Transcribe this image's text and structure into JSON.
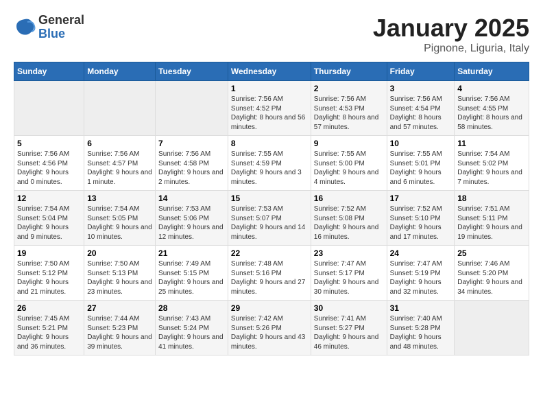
{
  "logo": {
    "general": "General",
    "blue": "Blue"
  },
  "title": {
    "month": "January 2025",
    "location": "Pignone, Liguria, Italy"
  },
  "headers": [
    "Sunday",
    "Monday",
    "Tuesday",
    "Wednesday",
    "Thursday",
    "Friday",
    "Saturday"
  ],
  "weeks": [
    [
      {
        "day": "",
        "info": ""
      },
      {
        "day": "",
        "info": ""
      },
      {
        "day": "",
        "info": ""
      },
      {
        "day": "1",
        "info": "Sunrise: 7:56 AM\nSunset: 4:52 PM\nDaylight: 8 hours\nand 56 minutes."
      },
      {
        "day": "2",
        "info": "Sunrise: 7:56 AM\nSunset: 4:53 PM\nDaylight: 8 hours\nand 57 minutes."
      },
      {
        "day": "3",
        "info": "Sunrise: 7:56 AM\nSunset: 4:54 PM\nDaylight: 8 hours\nand 57 minutes."
      },
      {
        "day": "4",
        "info": "Sunrise: 7:56 AM\nSunset: 4:55 PM\nDaylight: 8 hours\nand 58 minutes."
      }
    ],
    [
      {
        "day": "5",
        "info": "Sunrise: 7:56 AM\nSunset: 4:56 PM\nDaylight: 9 hours\nand 0 minutes."
      },
      {
        "day": "6",
        "info": "Sunrise: 7:56 AM\nSunset: 4:57 PM\nDaylight: 9 hours\nand 1 minute."
      },
      {
        "day": "7",
        "info": "Sunrise: 7:56 AM\nSunset: 4:58 PM\nDaylight: 9 hours\nand 2 minutes."
      },
      {
        "day": "8",
        "info": "Sunrise: 7:55 AM\nSunset: 4:59 PM\nDaylight: 9 hours\nand 3 minutes."
      },
      {
        "day": "9",
        "info": "Sunrise: 7:55 AM\nSunset: 5:00 PM\nDaylight: 9 hours\nand 4 minutes."
      },
      {
        "day": "10",
        "info": "Sunrise: 7:55 AM\nSunset: 5:01 PM\nDaylight: 9 hours\nand 6 minutes."
      },
      {
        "day": "11",
        "info": "Sunrise: 7:54 AM\nSunset: 5:02 PM\nDaylight: 9 hours\nand 7 minutes."
      }
    ],
    [
      {
        "day": "12",
        "info": "Sunrise: 7:54 AM\nSunset: 5:04 PM\nDaylight: 9 hours\nand 9 minutes."
      },
      {
        "day": "13",
        "info": "Sunrise: 7:54 AM\nSunset: 5:05 PM\nDaylight: 9 hours\nand 10 minutes."
      },
      {
        "day": "14",
        "info": "Sunrise: 7:53 AM\nSunset: 5:06 PM\nDaylight: 9 hours\nand 12 minutes."
      },
      {
        "day": "15",
        "info": "Sunrise: 7:53 AM\nSunset: 5:07 PM\nDaylight: 9 hours\nand 14 minutes."
      },
      {
        "day": "16",
        "info": "Sunrise: 7:52 AM\nSunset: 5:08 PM\nDaylight: 9 hours\nand 16 minutes."
      },
      {
        "day": "17",
        "info": "Sunrise: 7:52 AM\nSunset: 5:10 PM\nDaylight: 9 hours\nand 17 minutes."
      },
      {
        "day": "18",
        "info": "Sunrise: 7:51 AM\nSunset: 5:11 PM\nDaylight: 9 hours\nand 19 minutes."
      }
    ],
    [
      {
        "day": "19",
        "info": "Sunrise: 7:50 AM\nSunset: 5:12 PM\nDaylight: 9 hours\nand 21 minutes."
      },
      {
        "day": "20",
        "info": "Sunrise: 7:50 AM\nSunset: 5:13 PM\nDaylight: 9 hours\nand 23 minutes."
      },
      {
        "day": "21",
        "info": "Sunrise: 7:49 AM\nSunset: 5:15 PM\nDaylight: 9 hours\nand 25 minutes."
      },
      {
        "day": "22",
        "info": "Sunrise: 7:48 AM\nSunset: 5:16 PM\nDaylight: 9 hours\nand 27 minutes."
      },
      {
        "day": "23",
        "info": "Sunrise: 7:47 AM\nSunset: 5:17 PM\nDaylight: 9 hours\nand 30 minutes."
      },
      {
        "day": "24",
        "info": "Sunrise: 7:47 AM\nSunset: 5:19 PM\nDaylight: 9 hours\nand 32 minutes."
      },
      {
        "day": "25",
        "info": "Sunrise: 7:46 AM\nSunset: 5:20 PM\nDaylight: 9 hours\nand 34 minutes."
      }
    ],
    [
      {
        "day": "26",
        "info": "Sunrise: 7:45 AM\nSunset: 5:21 PM\nDaylight: 9 hours\nand 36 minutes."
      },
      {
        "day": "27",
        "info": "Sunrise: 7:44 AM\nSunset: 5:23 PM\nDaylight: 9 hours\nand 39 minutes."
      },
      {
        "day": "28",
        "info": "Sunrise: 7:43 AM\nSunset: 5:24 PM\nDaylight: 9 hours\nand 41 minutes."
      },
      {
        "day": "29",
        "info": "Sunrise: 7:42 AM\nSunset: 5:26 PM\nDaylight: 9 hours\nand 43 minutes."
      },
      {
        "day": "30",
        "info": "Sunrise: 7:41 AM\nSunset: 5:27 PM\nDaylight: 9 hours\nand 46 minutes."
      },
      {
        "day": "31",
        "info": "Sunrise: 7:40 AM\nSunset: 5:28 PM\nDaylight: 9 hours\nand 48 minutes."
      },
      {
        "day": "",
        "info": ""
      }
    ]
  ]
}
